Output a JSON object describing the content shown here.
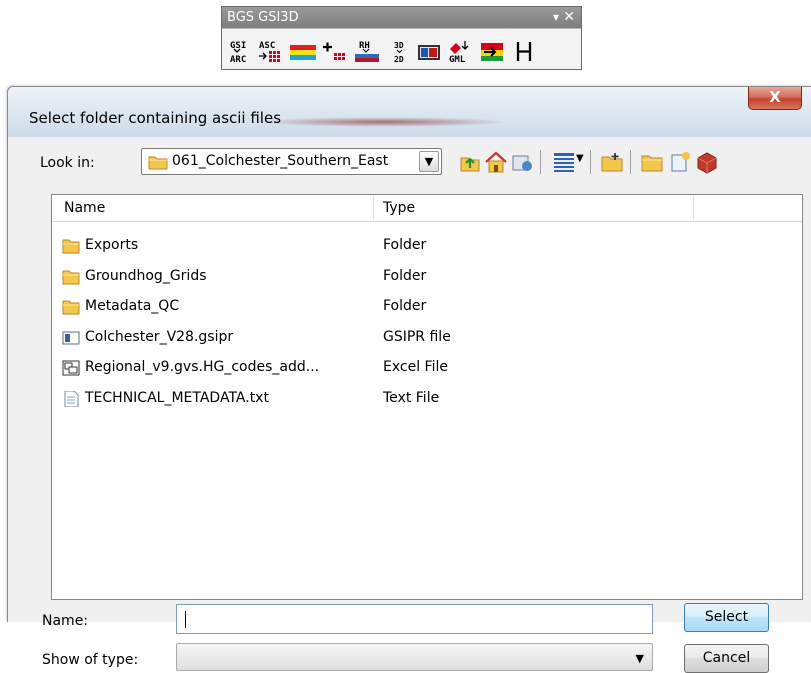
{
  "toolbar": {
    "title": "BGS GSI3D",
    "dropdown_glyph": "▾",
    "close_glyph": "✕",
    "tools": [
      {
        "icon": "gsi-arc-icon"
      },
      {
        "icon": "asc-grid-icon"
      },
      {
        "icon": "color-bars-icon"
      },
      {
        "icon": "plus-grid-icon"
      },
      {
        "icon": "rh-profile-icon"
      },
      {
        "icon": "3d-2d-icon"
      },
      {
        "icon": "display-icon"
      },
      {
        "icon": "gml-icon"
      },
      {
        "icon": "flag-arrow-icon"
      },
      {
        "icon": "h-icon",
        "text": "H"
      }
    ]
  },
  "dialog": {
    "title": "Select folder containing ascii files",
    "close_label": "X",
    "look_in_label": "Look in:",
    "look_in_value": "061_Colchester_Southern_East",
    "columns": [
      "Name",
      "Type"
    ],
    "files": [
      {
        "name": "Exports",
        "type": "Folder",
        "icon": "folder-icon"
      },
      {
        "name": "Groundhog_Grids",
        "type": "Folder",
        "icon": "folder-icon"
      },
      {
        "name": "Metadata_QC",
        "type": "Folder",
        "icon": "folder-icon"
      },
      {
        "name": "Colchester_V28.gsipr",
        "type": "GSIPR file",
        "icon": "gsipr-file-icon"
      },
      {
        "name": "Regional_v9.gvs.HG_codes_add...",
        "type": "Excel File",
        "icon": "excel-file-icon"
      },
      {
        "name": "TECHNICAL_METADATA.txt",
        "type": "Text File",
        "icon": "text-file-icon"
      }
    ],
    "name_label": "Name:",
    "name_value": "",
    "show_type_label": "Show of type:",
    "show_type_value": "",
    "select_label": "Select",
    "cancel_label": "Cancel"
  },
  "colors": {
    "folder": "#f1c84b",
    "close_button": "#c9452d",
    "accent_border": "#3c7fb1"
  }
}
